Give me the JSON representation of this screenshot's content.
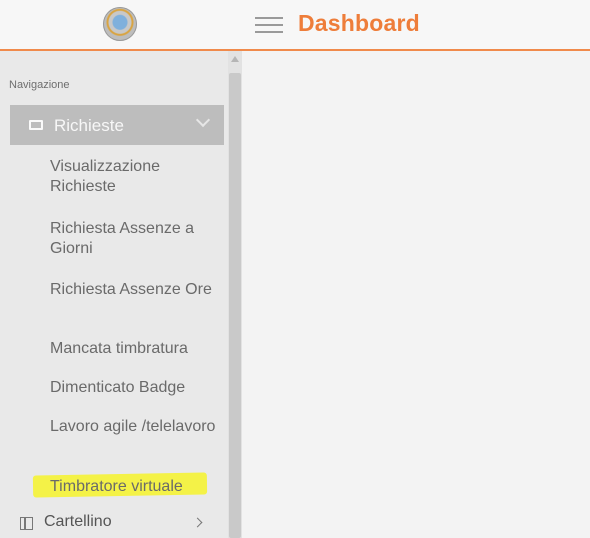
{
  "header": {
    "title": "Dashboard",
    "accent_color": "#ee7d3a",
    "logo_icon": "municipal-seal-logo",
    "menu_icon": "hamburger-menu-icon"
  },
  "sidebar": {
    "heading": "Navigazione",
    "group": {
      "label": "Richieste",
      "icon": "card-icon",
      "expanded": true,
      "items": [
        {
          "label": "Visualizzazione Richieste"
        },
        {
          "label": "Richiesta Assenze a Giorni"
        },
        {
          "label": "Richiesta Assenze Ore"
        },
        {
          "label": "Mancata timbratura"
        },
        {
          "label": "Dimenticato Badge"
        },
        {
          "label": "Lavoro agile /telelavoro"
        },
        {
          "label": "Timbratore virtuale",
          "highlighted": true,
          "highlight_color": "#f4f247"
        }
      ]
    },
    "next_item": {
      "label": "Cartellino",
      "icon": "book-icon"
    }
  }
}
